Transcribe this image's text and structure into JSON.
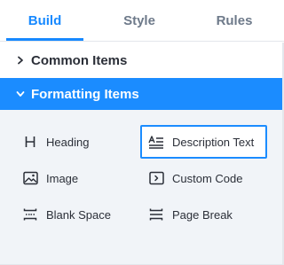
{
  "tabs": [
    {
      "label": "Build",
      "active": true
    },
    {
      "label": "Style",
      "active": false
    },
    {
      "label": "Rules",
      "active": false
    }
  ],
  "sections": {
    "common": {
      "label": "Common Items",
      "expanded": false
    },
    "formatting": {
      "label": "Formatting Items",
      "expanded": true
    }
  },
  "formatting_items": [
    {
      "label": "Heading",
      "icon": "heading-icon"
    },
    {
      "label": "Description Text",
      "icon": "description-text-icon",
      "selected": true
    },
    {
      "label": "Image",
      "icon": "image-icon"
    },
    {
      "label": "Custom Code",
      "icon": "code-icon"
    },
    {
      "label": "Blank Space",
      "icon": "blank-space-icon"
    },
    {
      "label": "Page Break",
      "icon": "page-break-icon"
    }
  ],
  "colors": {
    "accent": "#1b8cff",
    "active_tab_text": "#1789ff",
    "inactive_tab_text": "#6e7a8a",
    "panel_background": "#f1f4f8",
    "text": "#2b2f38"
  }
}
